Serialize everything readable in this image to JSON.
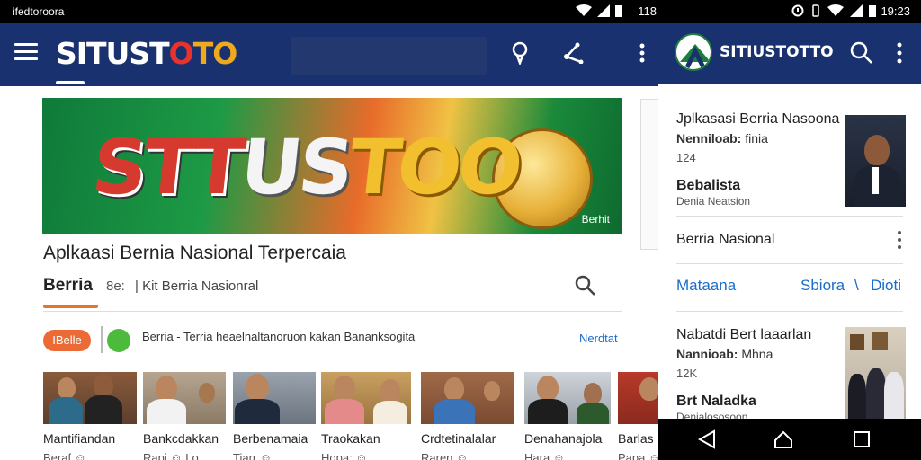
{
  "left_pane": {
    "status_bar": {
      "carrier": "ifedtoroora",
      "time": "118"
    },
    "app_bar": {
      "brand_parts": [
        "SITUST",
        "O",
        "T",
        "O"
      ],
      "menu_icon": "hamburger-icon",
      "actions": [
        "pin-icon",
        "share-icon",
        "more-vert-icon"
      ]
    },
    "banner": {
      "logo_parts": [
        "STT",
        "US",
        "TOO"
      ],
      "tag": "Berhit"
    },
    "headline": "Aplkaasi Bernia Nasional Terpercaia",
    "tabs": {
      "active": "Berria",
      "sub": "8e:",
      "sub2": "| Kit Berria Nasionral"
    },
    "ticker": {
      "chip": "IBelle",
      "text": "Berria - Terria heaelnaltanoruon kakan Bananksogita",
      "link": "Nerdtat"
    },
    "thumbs": [
      {
        "title": "Mantifiandan",
        "meta": "Beraf  ☺  "
      },
      {
        "title": "Bankcdakkan",
        "meta": "Rapi  ☺  Lo"
      },
      {
        "title": "Berbenamaia",
        "meta": "Tiarr  ☺  "
      },
      {
        "title": "Traokakan",
        "meta": "Hopa:  ☺  "
      },
      {
        "title": "Crdtetinalalar",
        "meta": "Raren  ☺  "
      },
      {
        "title": "Denahanajola",
        "meta": "Hara  ☺  "
      },
      {
        "title": "Barlas",
        "meta": "Papa  ☺  "
      }
    ]
  },
  "right_pane": {
    "status_bar": {
      "time": "19:23"
    },
    "app_bar": {
      "brand": "SITIUSTOTTO"
    },
    "card1": {
      "title": "Jplkasasi Berria Nasoona",
      "sub_label": "Nenniloab:",
      "sub_value": "finia",
      "num": "124",
      "section": "Bebalista",
      "section_sub": "Denia Neatsion"
    },
    "row_label": "Berria Nasional",
    "links": [
      "Mataana",
      "Sbiora",
      "\\",
      "Dioti"
    ],
    "card2": {
      "title": "Nabatdi Bert laaarlan",
      "sub_label": "Nannioab:",
      "sub_value": "Mhna",
      "num": "12K",
      "section": "Brt Naladka",
      "section_sub": "Denialososoon"
    },
    "nav": [
      "back-icon",
      "home-icon",
      "recents-icon"
    ]
  },
  "colors": {
    "app_bar": "#1a3170",
    "accent_orange": "#e8742a",
    "link_blue": "#1a6cc9",
    "chip_orange": "#ec6a35",
    "whatsapp_green": "#4cbb3c"
  }
}
